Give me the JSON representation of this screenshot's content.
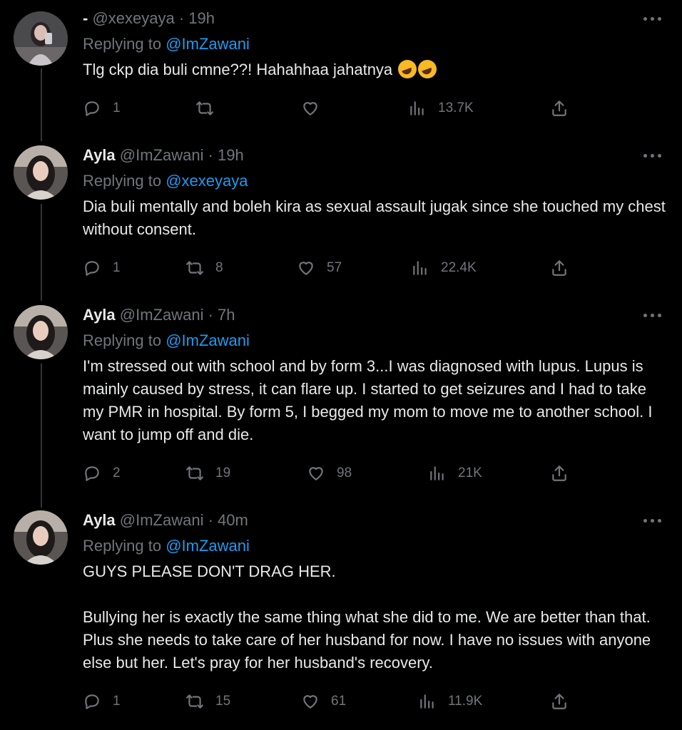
{
  "tweets": [
    {
      "name": "-",
      "handle": "@xexeyaya",
      "time": "· 19h",
      "reply_prefix": "Replying to",
      "reply_to": "@ImZawani",
      "paragraphs": [
        "Tlg ckp dia buli cmne??! Hahahhaa jahatnya"
      ],
      "emoji": [
        "rolling-on-floor-laughing",
        "rolling-on-floor-laughing"
      ],
      "replies": "1",
      "retweets": "",
      "likes": "",
      "views": "13.7K"
    },
    {
      "name": "Ayla",
      "handle": "@ImZawani",
      "time": "· 19h",
      "reply_prefix": "Replying to",
      "reply_to": "@xexeyaya",
      "paragraphs": [
        "Dia buli mentally and boleh kira as sexual assault jugak since she touched my chest without consent."
      ],
      "replies": "1",
      "retweets": "8",
      "likes": "57",
      "views": "22.4K"
    },
    {
      "name": "Ayla",
      "handle": "@ImZawani",
      "time": "· 7h",
      "reply_prefix": "Replying to",
      "reply_to": "@ImZawani",
      "paragraphs": [
        "I'm stressed out with school and by form 3...I was diagnosed with lupus. Lupus is mainly caused by stress, it can flare up. I started to get seizures and I had to take my PMR in hospital. By form 5, I begged my mom to move me to another school. I want to jump off and die."
      ],
      "replies": "2",
      "retweets": "19",
      "likes": "98",
      "views": "21K"
    },
    {
      "name": "Ayla",
      "handle": "@ImZawani",
      "time": "· 40m",
      "reply_prefix": "Replying to",
      "reply_to": "@ImZawani",
      "paragraphs": [
        "GUYS PLEASE DON'T DRAG HER.",
        "Bullying her is exactly the same thing what she did to me. We are better than that. Plus she needs to take care of her husband for now. I have no issues with anyone else but her. Let's pray for her husband's recovery."
      ],
      "replies": "1",
      "retweets": "15",
      "likes": "61",
      "views": "11.9K"
    }
  ],
  "colors": {
    "background": "#000000",
    "text": "#e7e9ea",
    "muted": "#71767b",
    "link": "#1d9bf0"
  },
  "icons": [
    "reply-icon",
    "retweet-icon",
    "like-icon",
    "views-icon",
    "share-icon",
    "more-icon"
  ]
}
